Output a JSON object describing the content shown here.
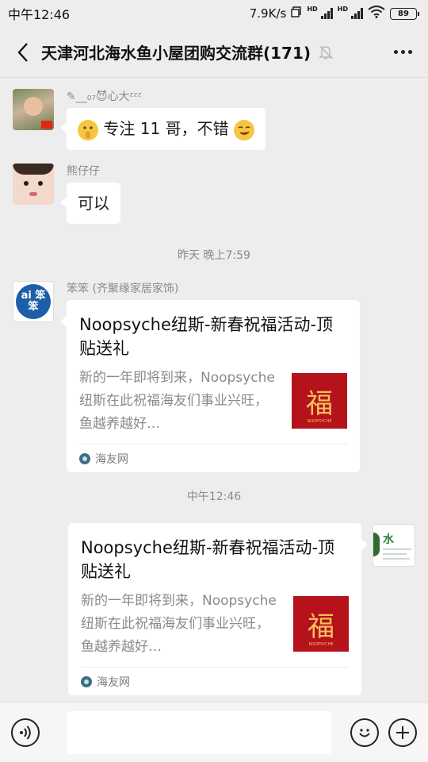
{
  "status_bar": {
    "time": "中午12:46",
    "speed": "7.9K/s",
    "hd1": "HD",
    "hd2": "HD",
    "battery": "89"
  },
  "header": {
    "title": "天津河北海水鱼小屋团购交流群(171)"
  },
  "messages": [
    {
      "sender": "✎__₀₇😈心大ᶻᶻᶻ",
      "text": "专注 11 哥，不错"
    },
    {
      "sender": "熊仔仔",
      "text": "可以"
    }
  ],
  "timestamps": [
    "昨天 晚上7:59",
    "中午12:46"
  ],
  "cards": [
    {
      "sender": "笨笨 (齐聚缘家居家饰)",
      "title": "Noopsyche纽斯-新春祝福活动-顶贴送礼",
      "desc": "新的一年即将到来，Noopsyche纽斯在此祝福海友们事业兴旺，鱼越养越好…",
      "thumb_char": "福",
      "source": "海友网"
    },
    {
      "title": "Noopsyche纽斯-新春祝福活动-顶贴送礼",
      "desc": "新的一年即将到来，Noopsyche纽斯在此祝福海友们事业兴旺，鱼越养越好…",
      "thumb_char": "福",
      "source": "海友网"
    }
  ],
  "self_avatar_char": "水",
  "benben_avatar_text": "ai 笨笨",
  "colors": {
    "background": "#ededed",
    "bubble": "#ffffff",
    "thumb_red": "#b5121b"
  }
}
